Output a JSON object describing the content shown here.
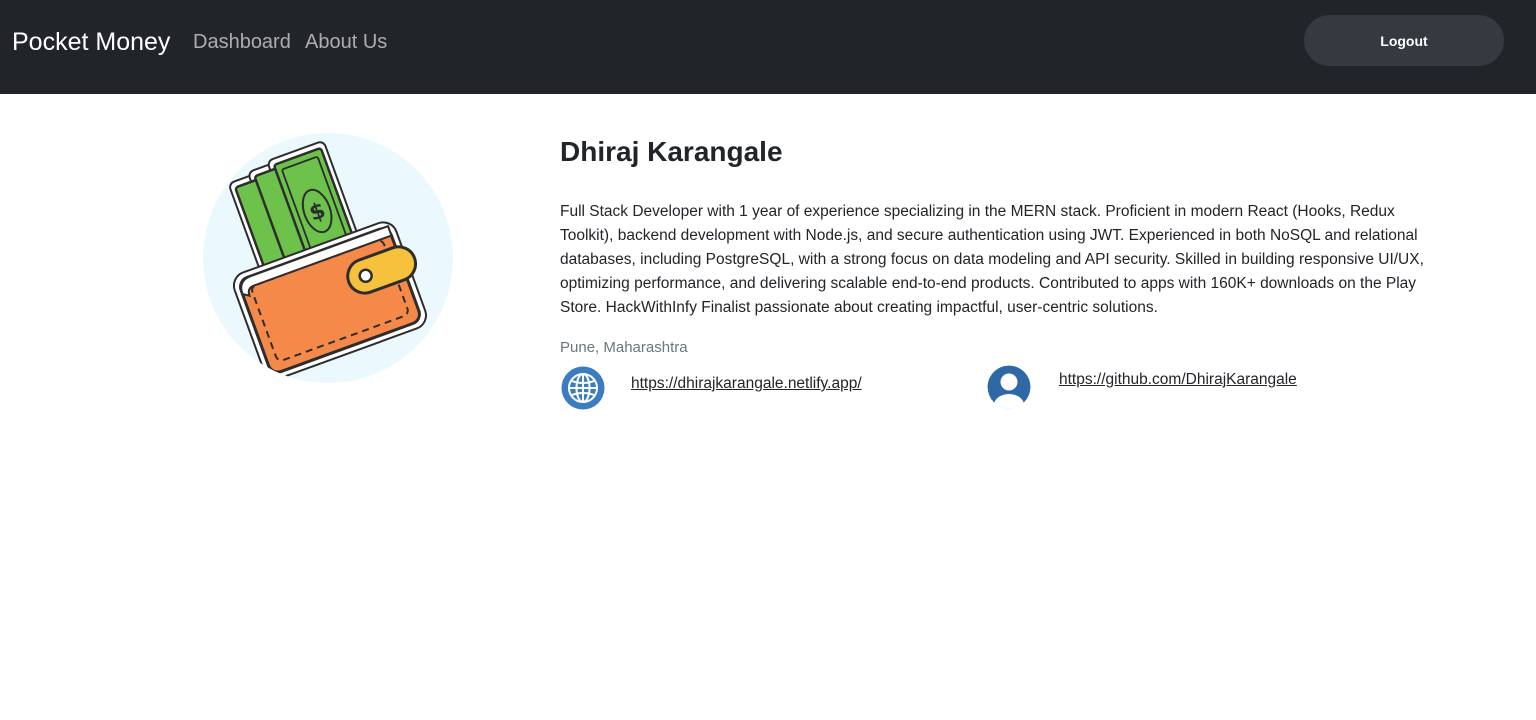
{
  "navbar": {
    "brand": "Pocket Money",
    "links": [
      "Dashboard",
      "About Us"
    ],
    "logout_label": "Logout"
  },
  "profile": {
    "avatar_icon": "wallet-money-icon",
    "name": "Dhiraj Karangale",
    "bio": "Full Stack Developer with 1 year of experience specializing in the MERN stack. Proficient in modern React (Hooks, Redux Toolkit), backend development with Node.js, and secure authentication using JWT. Experienced in both NoSQL and relational databases, including PostgreSQL, with a strong focus on data modeling and API security. Skilled in building responsive UI/UX, optimizing performance, and delivering scalable end-to-end products. Contributed to apps with 160K+ downloads on the Play Store. HackWithInfy Finalist passionate about creating impactful, user-centric solutions.",
    "location": "Pune, Maharashtra",
    "website": {
      "icon": "globe-icon",
      "url": "https://dhirajkarangale.netlify.app/"
    },
    "github": {
      "icon": "user-icon",
      "url": "https://github.com/DhirajKarangale"
    }
  },
  "colors": {
    "navbar_bg": "#212529",
    "logout_bg": "#343a40",
    "avatar_bg": "#ebf9fe",
    "icon_blue": "#3b7dc0"
  }
}
